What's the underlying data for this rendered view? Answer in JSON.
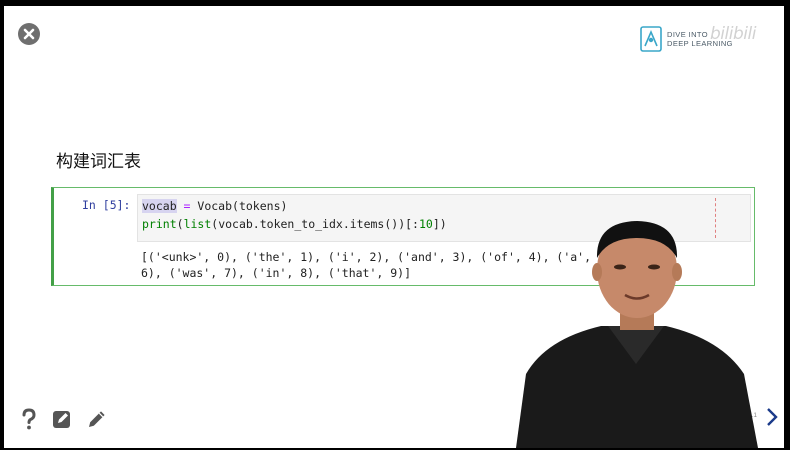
{
  "slide": {
    "title": "构建词汇表",
    "logo_text_line1": "DIVE INTO",
    "logo_text_line2": "DEEP LEARNING",
    "watermark": "bilibili",
    "slide_number": "5.1"
  },
  "cell": {
    "prompt": "In [5]:",
    "code": {
      "line1": {
        "selected": "vocab",
        "op": " = ",
        "rest": "Vocab(tokens)"
      },
      "line2": {
        "builtin1": "print",
        "p1": "(",
        "builtin2": "list",
        "mid": "(vocab.token_to_idx.items())[:",
        "num": "10",
        "end": "])"
      }
    },
    "output_lines": [
      "[('<unk>', 0), ('the', 1), ('i', 2), ('and', 3), ('of', 4), ('a', 5), ('to',",
      "6), ('was', 7), ('in', 8), ('that', 9)]"
    ]
  },
  "icons": {
    "close": "close-circle-icon",
    "help": "question-mark-icon",
    "edit_box": "edit-square-icon",
    "pencil": "pencil-icon",
    "prev": "chevron-left-icon",
    "next": "chevron-right-icon"
  },
  "colors": {
    "cell_border": "#66bb6a",
    "prompt": "#303f9f",
    "selection": "#d7d4f0",
    "nav_arrow": "#1a3a8a"
  }
}
